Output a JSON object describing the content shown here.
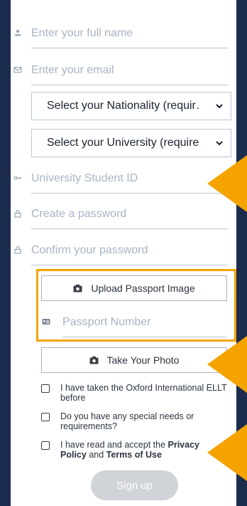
{
  "form": {
    "full_name": {
      "placeholder": "Enter your full name",
      "icon": "person-icon"
    },
    "email": {
      "placeholder": "Enter your email",
      "icon": "envelope-icon"
    },
    "nationality": {
      "value": "Select your Nationality (requir…"
    },
    "university": {
      "value": "Select your University (required)"
    },
    "student_id": {
      "placeholder": "University Student ID",
      "icon": "key-icon"
    },
    "password": {
      "placeholder": "Create a password",
      "icon": "lock-icon"
    },
    "confirm_password": {
      "placeholder": "Confirm your password",
      "icon": "lock-icon"
    },
    "upload_passport": {
      "label": "Upload Passport Image",
      "icon": "camera-icon"
    },
    "passport_number": {
      "placeholder": "Passport Number",
      "icon": "id-card-icon"
    },
    "take_photo": {
      "label": "Take Your Photo",
      "icon": "camera-icon"
    },
    "checkboxes": [
      {
        "label": "I have taken the Oxford International ELLT before"
      },
      {
        "label": "Do you have any special needs or requirements?"
      },
      {
        "prefix": "I have read and accept the ",
        "link1": "Privacy Policy",
        "middle": " and ",
        "link2": "Terms of Use"
      }
    ],
    "signup_label": "Sign up"
  },
  "colors": {
    "background": "#1c2c4f",
    "highlight": "#f5a300",
    "placeholder": "#a8b4c4",
    "disabled_button": "#d0d3d8"
  }
}
